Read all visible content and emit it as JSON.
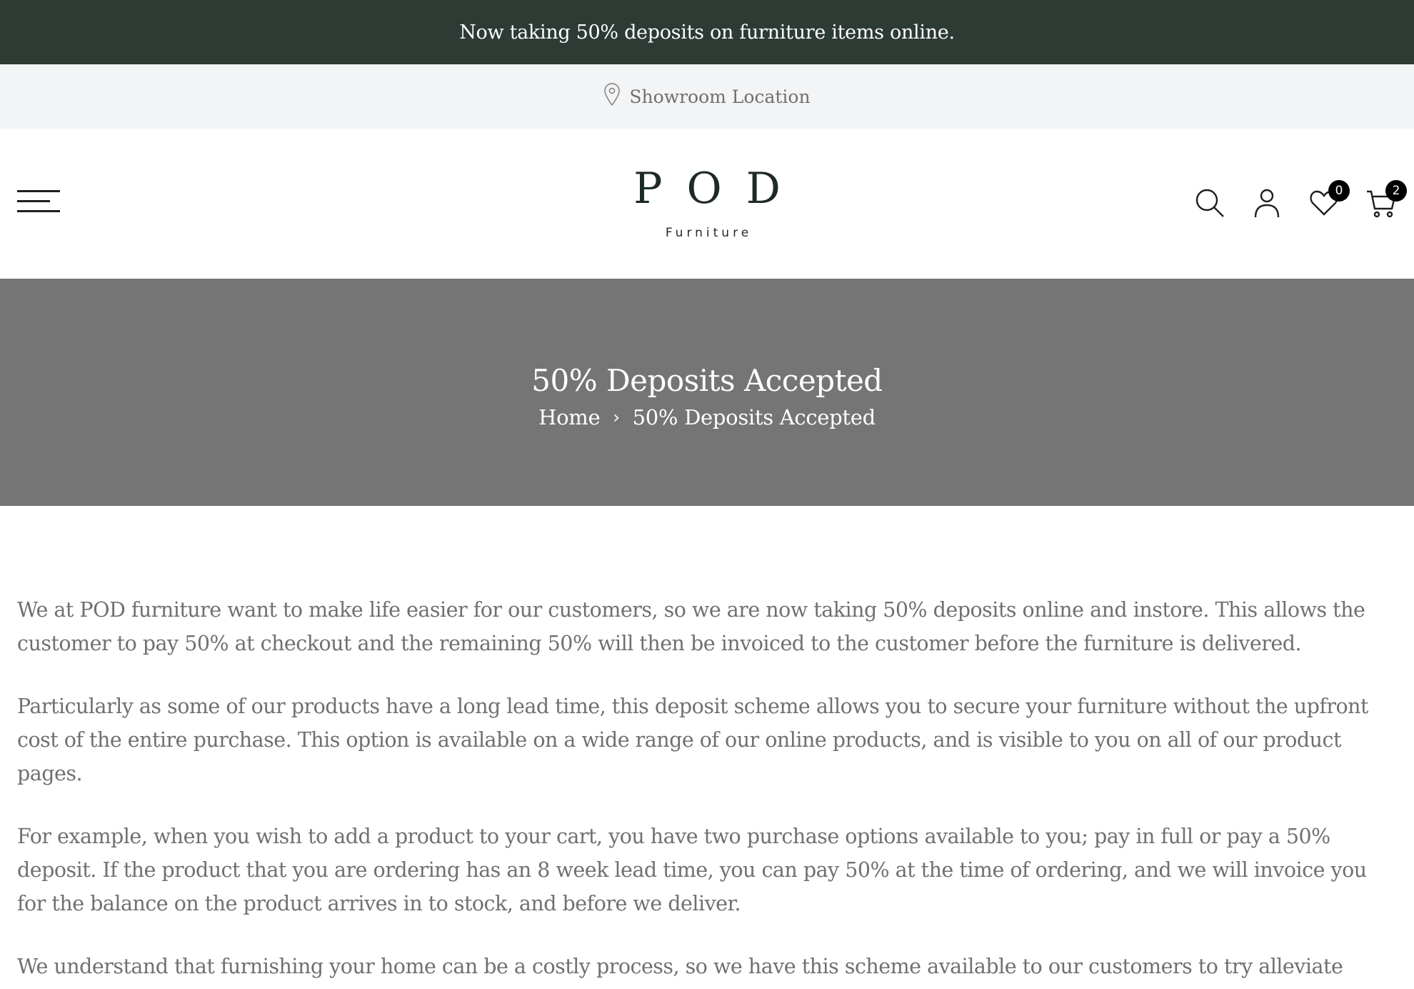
{
  "announcement": {
    "text": "Now taking 50% deposits on furniture items online."
  },
  "location_bar": {
    "icon": "map-pin-icon",
    "label": "Showroom Location"
  },
  "header": {
    "menu_icon": "hamburger-menu-icon",
    "logo": {
      "main": "POD",
      "sub": "Furniture"
    },
    "icons": {
      "search": "search-icon",
      "account": "user-icon",
      "wishlist": "heart-icon",
      "wishlist_count": "0",
      "cart": "cart-icon",
      "cart_count": "2"
    }
  },
  "hero": {
    "title": "50% Deposits Accepted",
    "breadcrumb": {
      "home": "Home",
      "separator": "›",
      "current": "50% Deposits Accepted"
    }
  },
  "content": {
    "paragraphs": [
      "We at POD furniture want to make life easier for our customers, so we are now taking 50% deposits online and instore. This allows the customer to pay 50% at checkout and the remaining 50% will then be invoiced to the customer before the furniture is delivered.",
      "Particularly as some of our products have a long lead time, this deposit scheme allows you to secure your furniture without the upfront cost of the entire purchase. This option is available on a wide range of our online products, and is visible to you on all of our product pages.",
      "For example, when you wish to add a product to your cart, you have two purchase options available to you; pay in full or pay a 50% deposit. If the product that you are ordering has an 8 week lead time, you can pay 50% at the time of ordering, and we will invoice you for the balance on the product arrives in to stock, and before we deliver.",
      "We understand that furnishing your home can be a costly process, so we have this scheme available to our customers to try alleviate some of the pressure when dealing with such costs."
    ]
  },
  "colors": {
    "announcement_bg": "#2d3b34",
    "location_bg": "#f3f4f6",
    "hero_bg": "#757575",
    "body_text": "#707070"
  }
}
